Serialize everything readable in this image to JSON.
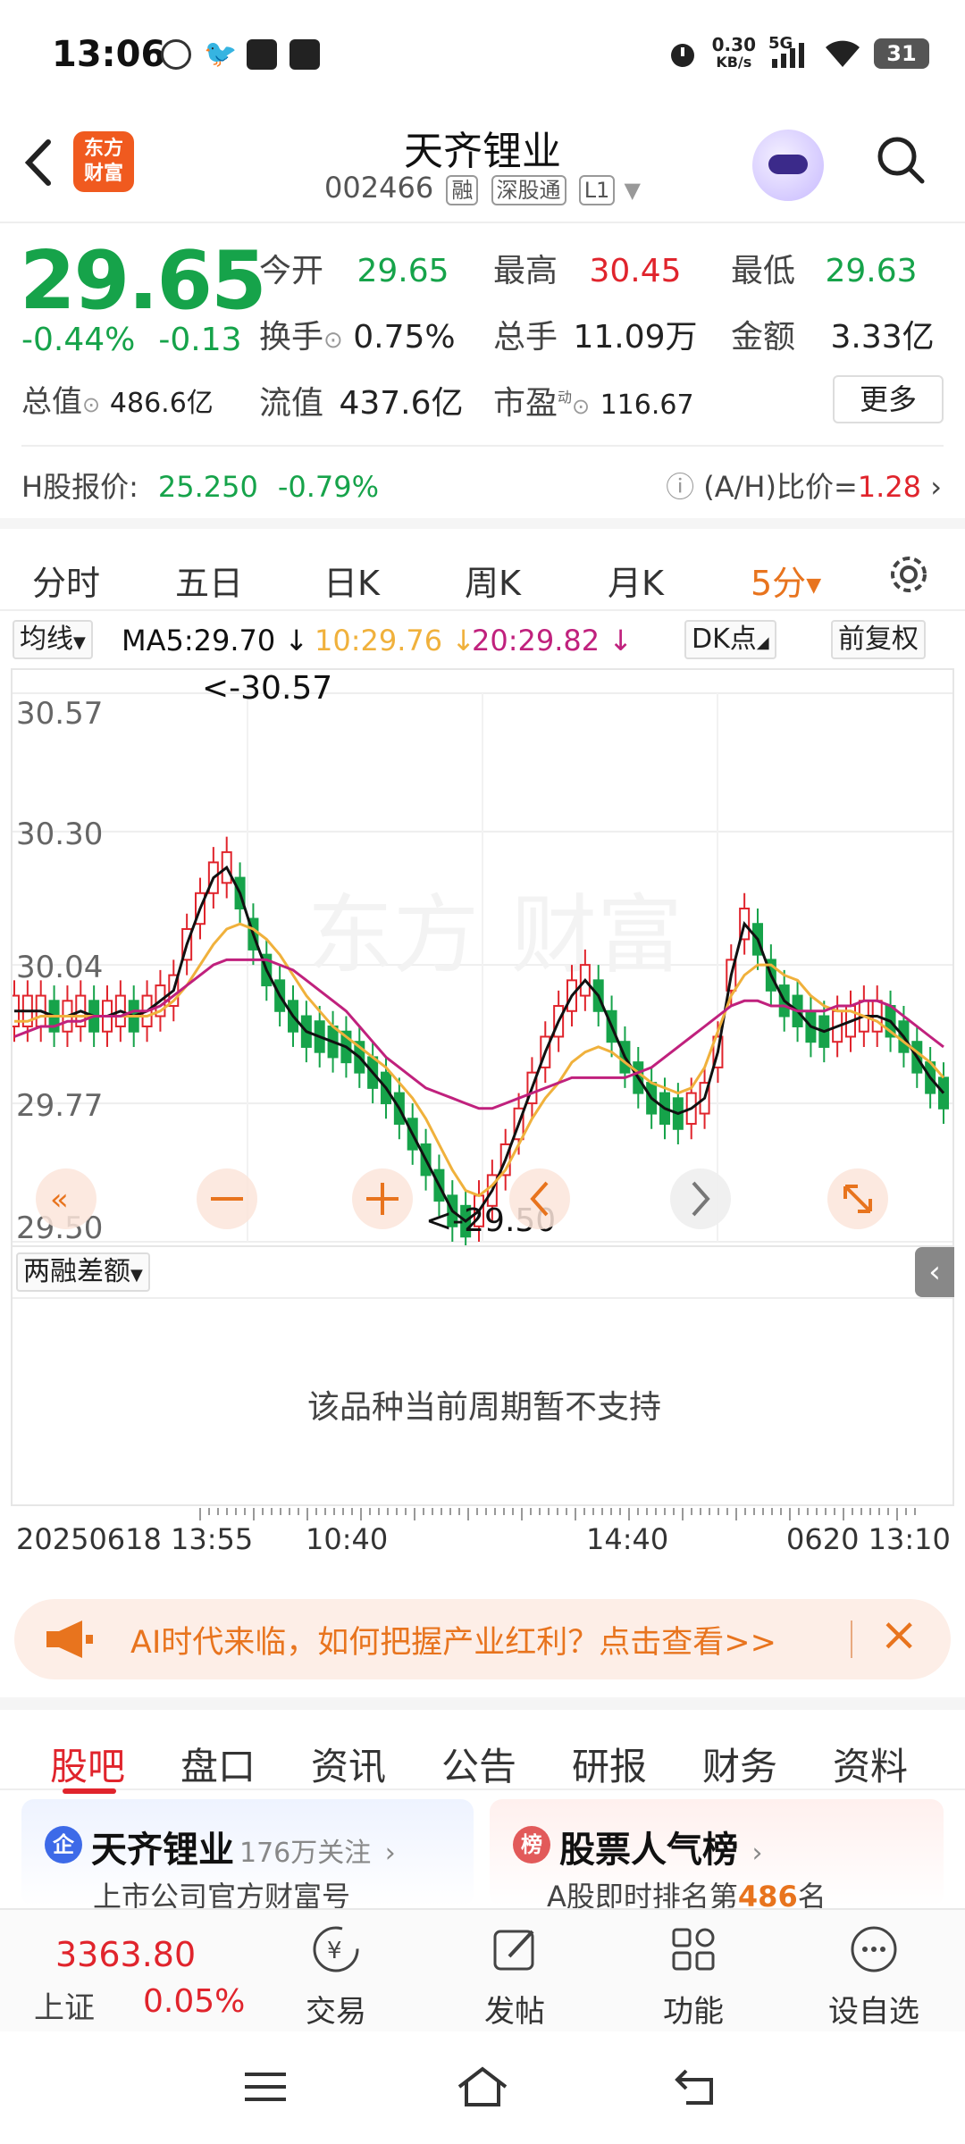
{
  "status_bar": {
    "time": "13:06",
    "net_speed_value": "0.30",
    "net_speed_unit": "KB/s",
    "network": "5G",
    "battery": "31"
  },
  "header": {
    "logo_text_1": "东方",
    "logo_text_2": "财富",
    "title": "天齐锂业",
    "code": "002466",
    "tags": [
      "融",
      "深股通",
      "L1"
    ]
  },
  "quote": {
    "price": "29.65",
    "change_pct": "-0.44%",
    "change_abs": "-0.13",
    "open_label": "今开",
    "open": "29.65",
    "high_label": "最高",
    "high": "30.45",
    "low_label": "最低",
    "low": "29.63",
    "turnover_rate_label": "换手",
    "turnover_rate": "0.75%",
    "volume_label": "总手",
    "volume": "11.09万",
    "amount_label": "金额",
    "amount": "3.33亿",
    "total_mv_label": "总值",
    "total_mv": "486.6亿",
    "float_mv_label": "流值",
    "float_mv": "437.6亿",
    "pe_label": "市盈",
    "pe_sup": "动",
    "pe": "116.67",
    "more_label": "更多"
  },
  "hshare": {
    "label": "H股报价:",
    "price": "25.250",
    "change": "-0.79%",
    "ah_label": "(A/H)比价=",
    "ah_value": "1.28"
  },
  "chart_tabs": [
    "分时",
    "五日",
    "日K",
    "周K",
    "月K",
    "5分"
  ],
  "active_chart_tab": "5分",
  "indicator": {
    "selector": "均线",
    "ma5": "MA5:29.70 ↓",
    "ma10": "10:29.76 ↓",
    "ma20": "20:29.82 ↓",
    "dk_label": "DK点",
    "adjust_label": "前复权"
  },
  "chart_data": {
    "type": "candlestick",
    "y_ticks": [
      "30.57",
      "30.30",
      "30.04",
      "29.77",
      "29.50"
    ],
    "ylim": [
      29.5,
      30.57
    ],
    "max_label": "<-30.57",
    "min_label": "<-29.50",
    "x_ticks": [
      "20250618 13:55",
      "10:40",
      "14:40",
      "0620 13:10"
    ],
    "series": [
      {
        "name": "MA5",
        "color": "#111111",
        "values": [
          29.95,
          29.95,
          29.95,
          29.94,
          29.94,
          29.95,
          29.94,
          29.94,
          29.95,
          29.94,
          29.95,
          29.97,
          29.99,
          30.08,
          30.15,
          30.21,
          30.23,
          30.18,
          30.1,
          30.03,
          29.98,
          29.94,
          29.91,
          29.9,
          29.89,
          29.88,
          29.86,
          29.83,
          29.8,
          29.76,
          29.71,
          29.66,
          29.61,
          29.56,
          29.54,
          29.56,
          29.6,
          29.66,
          29.73,
          29.8,
          29.87,
          29.93,
          29.98,
          30.01,
          29.98,
          29.92,
          29.86,
          29.82,
          29.78,
          29.76,
          29.75,
          29.76,
          29.78,
          29.87,
          30.02,
          30.12,
          30.09,
          30.02,
          29.97,
          29.95,
          29.92,
          29.91,
          29.92,
          29.93,
          29.94,
          29.94,
          29.93,
          29.9,
          29.86,
          29.82,
          29.79
        ]
      },
      {
        "name": "MA10",
        "color": "#f0b13c",
        "values": [
          29.93,
          29.93,
          29.94,
          29.94,
          29.94,
          29.94,
          29.94,
          29.94,
          29.94,
          29.94,
          29.94,
          29.95,
          29.97,
          30.0,
          30.04,
          30.08,
          30.11,
          30.12,
          30.11,
          30.09,
          30.06,
          30.02,
          29.98,
          29.95,
          29.92,
          29.9,
          29.88,
          29.86,
          29.84,
          29.81,
          29.78,
          29.74,
          29.69,
          29.64,
          29.6,
          29.59,
          29.61,
          29.64,
          29.69,
          29.74,
          29.78,
          29.81,
          29.85,
          29.87,
          29.88,
          29.87,
          29.85,
          29.83,
          29.81,
          29.8,
          29.79,
          29.8,
          29.84,
          29.91,
          29.98,
          30.02,
          30.04,
          30.04,
          30.02,
          30.01,
          29.98,
          29.96,
          29.95,
          29.95,
          29.94,
          29.93,
          29.91,
          29.89,
          29.87,
          29.85,
          29.82
        ]
      },
      {
        "name": "MA20",
        "color": "#c0217d",
        "values": [
          29.9,
          29.91,
          29.92,
          29.92,
          29.93,
          29.93,
          29.94,
          29.94,
          29.94,
          29.95,
          29.95,
          29.96,
          29.98,
          30.0,
          30.02,
          30.04,
          30.05,
          30.05,
          30.05,
          30.05,
          30.04,
          30.03,
          30.01,
          29.99,
          29.97,
          29.95,
          29.92,
          29.89,
          29.86,
          29.84,
          29.82,
          29.8,
          29.79,
          29.78,
          29.77,
          29.76,
          29.76,
          29.77,
          29.78,
          29.79,
          29.8,
          29.81,
          29.82,
          29.82,
          29.82,
          29.82,
          29.82,
          29.83,
          29.84,
          29.86,
          29.88,
          29.9,
          29.92,
          29.94,
          29.96,
          29.97,
          29.97,
          29.96,
          29.96,
          29.95,
          29.95,
          29.95,
          29.96,
          29.96,
          29.97,
          29.97,
          29.96,
          29.94,
          29.92,
          29.9,
          29.88
        ]
      }
    ]
  },
  "sub_indicator": {
    "selector": "两融差额",
    "message": "该品种当前周期暂不支持"
  },
  "banner": {
    "text": "AI时代来临，如何把握产业红利？点击查看>>"
  },
  "section_tabs": [
    "股吧",
    "盘口",
    "资讯",
    "公告",
    "研报",
    "财务",
    "资料"
  ],
  "active_section_tab": "股吧",
  "cards": [
    {
      "badge": "企",
      "title": "天齐锂业",
      "follow": "176万关注",
      "sub": "上市公司官方财富号"
    },
    {
      "badge": "榜",
      "title": "股票人气榜",
      "sub_prefix": "A股即时排名第",
      "rank": "486",
      "sub_suffix": "名"
    }
  ],
  "bottom_bar": {
    "index_value": "3363.80",
    "index_name": "上证",
    "index_change": "0.05%",
    "nav": [
      "交易",
      "发帖",
      "功能",
      "设自选"
    ]
  },
  "colors": {
    "up": "#e0242c",
    "down": "#16a34a",
    "accent": "#e8741e"
  }
}
